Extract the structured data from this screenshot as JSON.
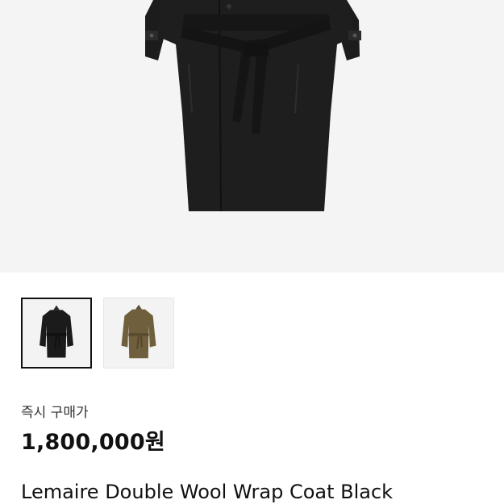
{
  "product": {
    "image_alt": "black wool wrap coat",
    "thumbnails": [
      {
        "name": "thumbnail-black-coat",
        "color": "#1b1b1b",
        "selected": true
      },
      {
        "name": "thumbnail-olive-coat",
        "color": "#6f5f3c",
        "selected": false
      }
    ],
    "price_label": "즉시 구매가",
    "price": "1,800,000원",
    "title": "Lemaire Double Wool Wrap Coat Black"
  }
}
